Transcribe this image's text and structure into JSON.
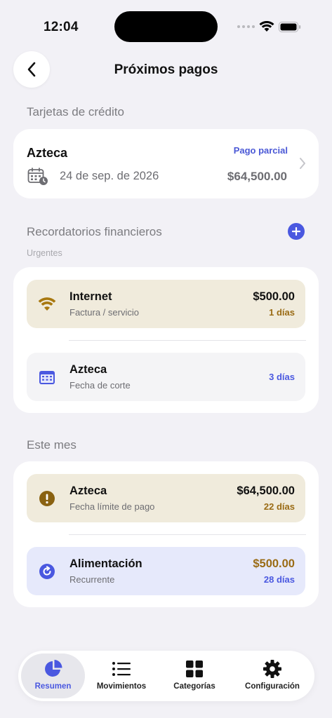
{
  "status_bar": {
    "time": "12:04"
  },
  "header": {
    "title": "Próximos pagos"
  },
  "credit_cards": {
    "section_label": "Tarjetas de crédito",
    "card": {
      "name": "Azteca",
      "badge": "Pago parcial",
      "date": "24 de sep. de 2026",
      "amount": "$64,500.00"
    }
  },
  "reminders": {
    "section_label": "Recordatorios financieros",
    "sub_label": "Urgentes",
    "items": [
      {
        "title": "Internet",
        "subtitle": "Factura / servicio",
        "amount": "$500.00",
        "days": "1 días",
        "icon": "wifi-icon"
      },
      {
        "title": "Azteca",
        "subtitle": "Fecha de corte",
        "amount": "",
        "days": "3 días",
        "icon": "calendar-icon"
      }
    ]
  },
  "this_month": {
    "section_label": "Este mes",
    "items": [
      {
        "title": "Azteca",
        "subtitle": "Fecha límite de pago",
        "amount": "$64,500.00",
        "days": "22 días",
        "icon": "exclamation-icon"
      },
      {
        "title": "Alimentación",
        "subtitle": "Recurrente",
        "amount": "$500.00",
        "days": "28 días",
        "icon": "recurring-icon"
      }
    ]
  },
  "tab_bar": {
    "tabs": [
      {
        "label": "Resumen",
        "icon": "pie-chart-icon",
        "active": true
      },
      {
        "label": "Movimientos",
        "icon": "list-icon",
        "active": false
      },
      {
        "label": "Categorías",
        "icon": "grid-icon",
        "active": false
      },
      {
        "label": "Configuración",
        "icon": "gear-icon",
        "active": false
      }
    ]
  },
  "colors": {
    "accent": "#4a58e0",
    "warning_bg": "#f0ebdc",
    "warning_text": "#9a6b14",
    "neutral_bg": "#f4f4f6",
    "blue_bg": "#e6e9fb"
  }
}
